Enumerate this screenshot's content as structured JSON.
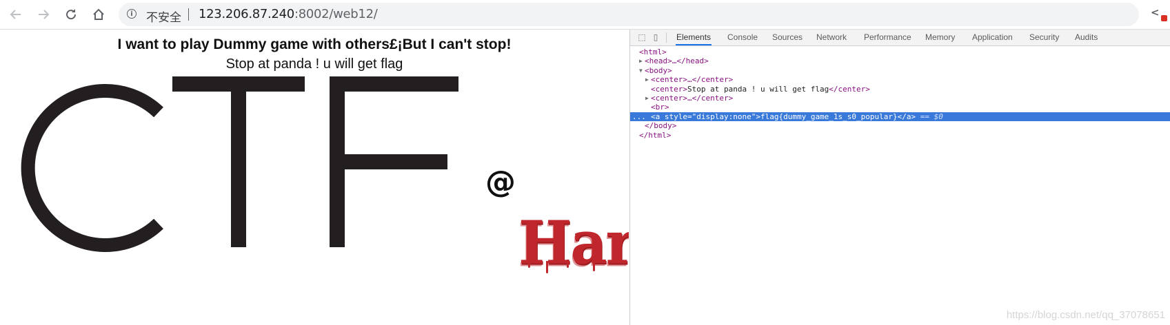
{
  "browser": {
    "security_label": "不安全",
    "url_host": "123.206.87.240",
    "url_rest": ":8002/web12/",
    "info_glyph": "i",
    "icons": [
      "back-arrow-icon",
      "forward-arrow-icon",
      "reload-icon",
      "home-icon",
      "info-icon",
      "extension-icon"
    ]
  },
  "page": {
    "heading": "I want to play Dummy game with others£¡But I can't stop!",
    "subheading": "Stop at panda ! u will get flag",
    "logo_text": "CTF",
    "at_sign": "@",
    "signature_text": "Harr",
    "logo_color": "#231f20",
    "signature_color": "#c0272d"
  },
  "devtools": {
    "tabs": [
      {
        "label": "Elements",
        "active": true
      },
      {
        "label": "Console"
      },
      {
        "label": "Sources"
      },
      {
        "label": "Network"
      },
      {
        "label": "Performance"
      },
      {
        "label": "Memory"
      },
      {
        "label": "Application"
      },
      {
        "label": "Security"
      },
      {
        "label": "Audits"
      }
    ],
    "dom": {
      "html_open": "<html>",
      "head": "<head>…</head>",
      "body_open": "<body>",
      "center1": "<center>…</center>",
      "center2_open": "<center>",
      "center2_text": "Stop at panda ! u will get flag",
      "center2_close": "</center>",
      "center3": "<center>…</center>",
      "br": "<br>",
      "sel_dots": "...",
      "a_open_start": "<a ",
      "a_attr_name": "style",
      "a_attr_eq": "=",
      "a_attr_value": "\"display:none\"",
      "a_open_end": ">",
      "a_text": "flag{dummy_game_1s_s0_popular}",
      "a_close": "</a>",
      "eq_ref": " == $0",
      "body_close": "</body>",
      "html_close": "</html>"
    },
    "selection_color": "#3879d9"
  },
  "watermark": "https://blog.csdn.net/qq_37078651"
}
